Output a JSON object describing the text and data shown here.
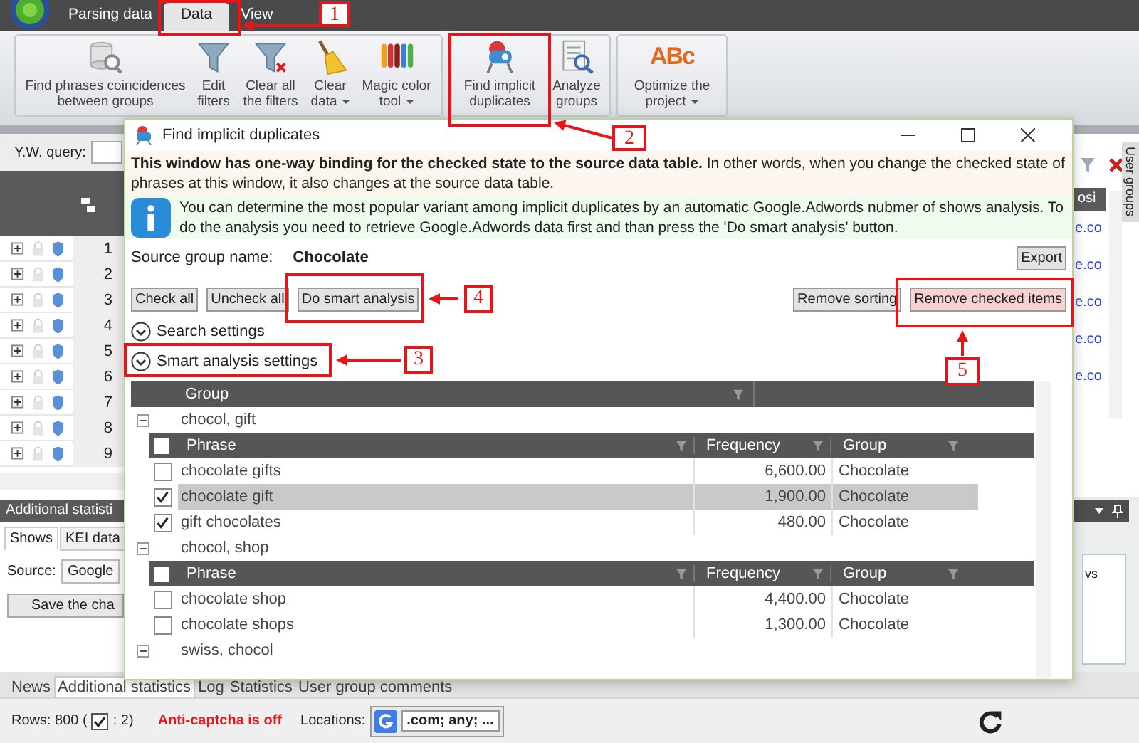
{
  "tabs": [
    {
      "label": "Parsing data",
      "selected": false
    },
    {
      "label": "Data",
      "selected": true
    },
    {
      "label": "View",
      "selected": false
    }
  ],
  "ribbon": {
    "groups": [
      {
        "items": [
          {
            "label": "Find phrases coincidences between groups",
            "kind": "database",
            "dropdown": false
          },
          {
            "label": "Edit filters",
            "kind": "funnel",
            "dropdown": false
          },
          {
            "label": "Clear all the filters",
            "kind": "clear",
            "dropdown": false
          },
          {
            "label": "Clear data",
            "kind": "broom",
            "dropdown": true
          },
          {
            "label": "Magic color tool",
            "kind": "colors",
            "dropdown": true
          }
        ]
      },
      {
        "items": [
          {
            "label": "Find implicit duplicates",
            "kind": "robot",
            "dropdown": false
          },
          {
            "label": "Analyze groups",
            "kind": "report",
            "dropdown": false
          }
        ]
      },
      {
        "items": [
          {
            "label": "Optimize the project",
            "kind": "glyph",
            "glyph": "ABc",
            "dropdown": true
          }
        ]
      }
    ]
  },
  "query": {
    "label": "Y.W. query:"
  },
  "left_grid": {
    "rows": [
      {
        "number": "1"
      },
      {
        "number": "2"
      },
      {
        "number": "3"
      },
      {
        "number": "4"
      },
      {
        "number": "5"
      },
      {
        "number": "6"
      },
      {
        "number": "7"
      },
      {
        "number": "8"
      },
      {
        "number": "9"
      }
    ]
  },
  "right_strip": {
    "header": "osi",
    "links": [
      "e.co",
      "e.co",
      "e.co",
      "e.co",
      "e.co"
    ],
    "tab": "User groups"
  },
  "stats_panel": {
    "title": "Additional statisti",
    "tabs": [
      {
        "label": "Shows",
        "selected": true
      },
      {
        "label": "KEI data",
        "selected": false
      }
    ],
    "source_label": "Source:",
    "source_value": "Google",
    "save_button": "Save the cha",
    "side_text": "vs"
  },
  "bottom_tabs": [
    {
      "label": "News",
      "selected": false
    },
    {
      "label": "Additional statistics",
      "selected": true
    },
    {
      "label": "Log",
      "selected": false
    },
    {
      "label": "Statistics",
      "selected": false
    },
    {
      "label": "User group comments",
      "selected": false
    }
  ],
  "status": {
    "rows_label": "Rows: 800 (",
    "rows_checked": ": 2)",
    "captcha": "Anti-captcha is off",
    "locations_label": "Locations:",
    "locations_value": ".com; any; ..."
  },
  "dialog": {
    "title": "Find implicit duplicates",
    "notice": "**This window has one-way binding for the checked state to the source data table.** In other words, when you change the checked state of phrases at this window, it also changes at the source data table.",
    "info": "You can determine the most popular variant among implicit duplicates by an automatic Google.Adwords nubmer of shows analysis. To do the analysis you need to retrieve Google.Adwords data first and than press the 'Do smart analysis' button.",
    "source_label": "Source group name:",
    "source_value": "Chocolate",
    "export_button": "Export",
    "left_buttons": [
      "Check all",
      "Uncheck all",
      "Do smart analysis"
    ],
    "right_buttons": [
      {
        "label": "Remove sorting",
        "kind": "normal"
      },
      {
        "label": "Remove checked items",
        "kind": "danger"
      }
    ],
    "expanders": [
      "Search settings",
      "Smart analysis settings"
    ],
    "group_column": "Group",
    "groups": [
      {
        "name": "chocol, gift",
        "columns": [
          "Phrase",
          "Frequency",
          "Group"
        ],
        "header_checked": false,
        "phrases": [
          {
            "phrase": "chocolate gifts",
            "frequency": "6,600.00",
            "group": "Chocolate",
            "checked": false,
            "selected": false
          },
          {
            "phrase": "chocolate gift",
            "frequency": "1,900.00",
            "group": "Chocolate",
            "checked": true,
            "selected": true
          },
          {
            "phrase": "gift chocolates",
            "frequency": "480.00",
            "group": "Chocolate",
            "checked": true,
            "selected": false
          }
        ]
      },
      {
        "name": "chocol, shop",
        "columns": [
          "Phrase",
          "Frequency",
          "Group"
        ],
        "header_checked": false,
        "phrases": [
          {
            "phrase": "chocolate shop",
            "frequency": "4,400.00",
            "group": "Chocolate",
            "checked": false,
            "selected": false
          },
          {
            "phrase": "chocolate shops",
            "frequency": "1,300.00",
            "group": "Chocolate",
            "checked": false,
            "selected": false
          }
        ]
      },
      {
        "name": "swiss, chocol"
      }
    ]
  },
  "annotations": [
    {
      "number": "1"
    },
    {
      "number": "2"
    },
    {
      "number": "3"
    },
    {
      "number": "4"
    },
    {
      "number": "5"
    }
  ]
}
